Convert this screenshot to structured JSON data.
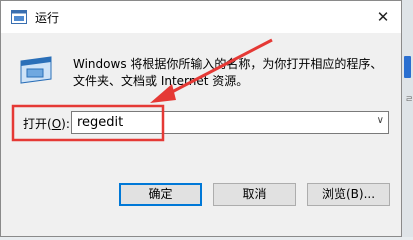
{
  "window": {
    "title": "运行",
    "close_glyph": "✕"
  },
  "description": {
    "line1": "Windows 将根据你所输入的名称，为你打开相应的程序、",
    "line2": "文件夹、文档或 Internet 资源。"
  },
  "open_field": {
    "label": "打开(",
    "mnemonic": "O",
    "label_end": "):",
    "value": "regedit"
  },
  "buttons": {
    "ok": "确定",
    "cancel": "取消",
    "browse": "浏览(B)..."
  },
  "annotation": {
    "color": "#e53935"
  },
  "icons": [
    "run-app-icon",
    "run-program-icon",
    "close-icon",
    "dropdown-arrow-icon"
  ]
}
